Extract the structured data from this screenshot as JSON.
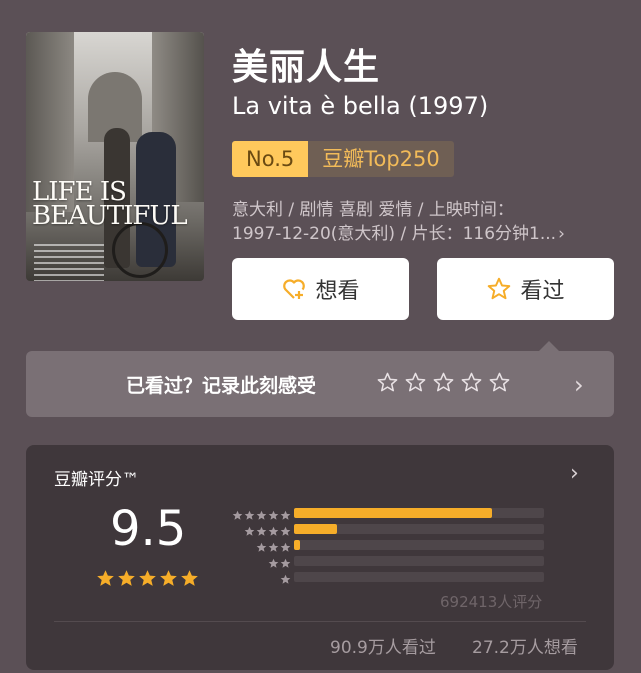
{
  "poster": {
    "title_text": "LIFE IS\nBEAUTIFUL"
  },
  "movie": {
    "title_cn": "美丽人生",
    "title_en": "La vita è bella (1997)",
    "rank_no": "No.5",
    "rank_list": "豆瓣Top250",
    "meta_line1": "意大利 / 剧情 喜剧 爱情 / 上映时间：",
    "meta_line2": "1997-12-20(意大利) / 片长：116分钟1...",
    "meta_more": "›"
  },
  "actions": {
    "want_label": "想看",
    "seen_label": "看过"
  },
  "record": {
    "label": "已看过？记录此刻感受",
    "arrow": "›"
  },
  "rating": {
    "header": "豆瓣评分™",
    "header_arrow": "›",
    "score": "9.5",
    "stars_filled": 5,
    "distribution": [
      {
        "stars": 5,
        "fraction": 0.79
      },
      {
        "stars": 4,
        "fraction": 0.17
      },
      {
        "stars": 3,
        "fraction": 0.025
      },
      {
        "stars": 2,
        "fraction": 0.0
      },
      {
        "stars": 1,
        "fraction": 0.0
      }
    ],
    "count_text": "692413人评分",
    "watched_text": "90.9万人看过",
    "wishing_text": "27.2万人想看"
  },
  "colors": {
    "accent": "#f6ad29",
    "rank_bg": "#ffc95c",
    "background": "#5b5056"
  },
  "icons": {
    "want": "heart-plus-icon",
    "seen": "star-outline-icon"
  }
}
